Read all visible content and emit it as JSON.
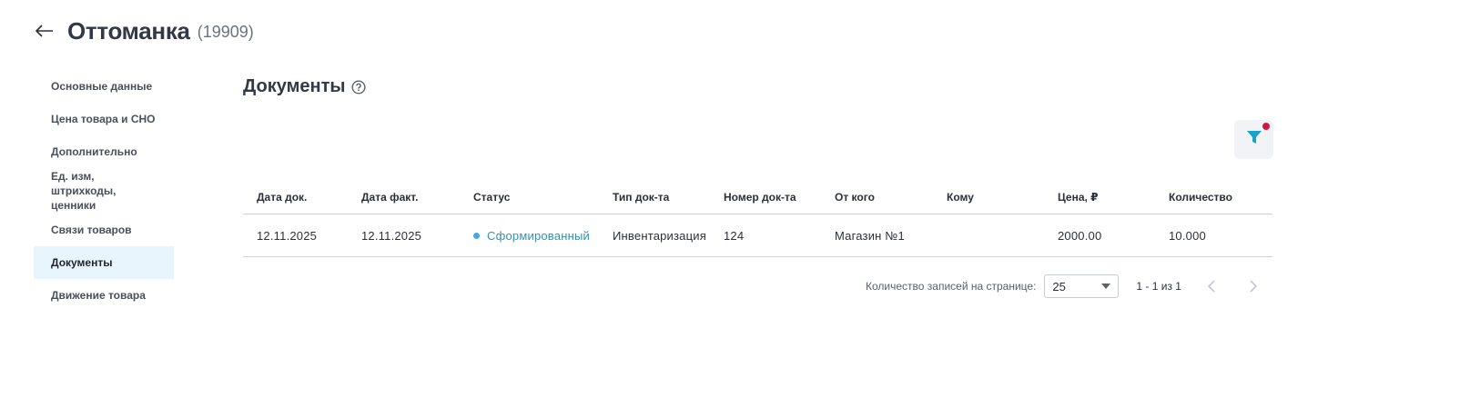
{
  "header": {
    "title": "Оттоманка",
    "id_text": "(19909)"
  },
  "sidebar": {
    "items": [
      {
        "label": "Основные данные",
        "active": false
      },
      {
        "label": "Цена товара и СНО",
        "active": false
      },
      {
        "label": "Дополнительно",
        "active": false
      },
      {
        "label": "Ед. изм, штрихкоды, ценники",
        "active": false
      },
      {
        "label": "Связи товаров",
        "active": false
      },
      {
        "label": "Документы",
        "active": true
      },
      {
        "label": "Движение товара",
        "active": false
      }
    ]
  },
  "section": {
    "title": "Документы"
  },
  "table": {
    "columns": [
      "Дата док.",
      "Дата факт.",
      "Статус",
      "Тип док-та",
      "Номер док-та",
      "От кого",
      "Кому",
      "Цена, ₽",
      "Количество"
    ],
    "rows": [
      {
        "date_doc": "12.11.2025",
        "date_fact": "12.11.2025",
        "status": "Сформированный",
        "doc_type": "Инвентаризация",
        "doc_number": "124",
        "from": "Магазин №1",
        "to": "",
        "price": "2000.00",
        "quantity": "10.000"
      }
    ]
  },
  "pagination": {
    "per_page_label": "Количество записей на странице:",
    "per_page_value": "25",
    "range": "1 - 1 из 1"
  },
  "colors": {
    "accent": "#2b95b4",
    "active_bg": "#e9f5fc",
    "filter_icon": "#1aa3c9",
    "filter_dot": "#d4183d"
  }
}
